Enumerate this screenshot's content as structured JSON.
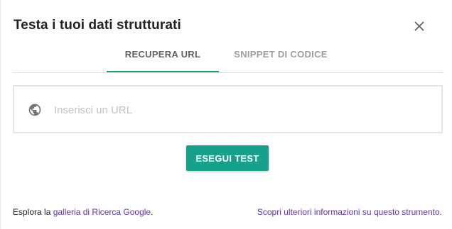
{
  "dialog": {
    "title": "Testa i tuoi dati strutturati"
  },
  "tabs": [
    {
      "label": "RECUPERA URL",
      "active": true
    },
    {
      "label": "SNIPPET DI CODICE",
      "active": false
    }
  ],
  "url_input": {
    "placeholder": "Inserisci un URL",
    "value": ""
  },
  "run_button": {
    "label": "ESEGUI TEST"
  },
  "footer": {
    "left_prefix": "Esplora la ",
    "left_link": "galleria di Ricerca Google",
    "left_suffix": ".",
    "right_link": "Scopri ulteriori informazioni su questo strumento."
  },
  "icons": {
    "close": "close-icon",
    "globe": "globe-icon"
  },
  "colors": {
    "accent": "#17a08b",
    "link": "#5e35b1",
    "active_tab_text": "#5f6368",
    "inactive_tab_text": "#9e9e9e"
  }
}
